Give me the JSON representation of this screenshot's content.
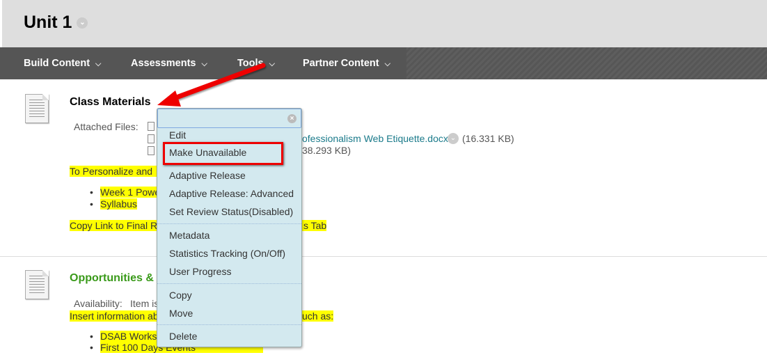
{
  "page": {
    "title": "Unit 1"
  },
  "nav": {
    "items": [
      {
        "label": "Build Content"
      },
      {
        "label": "Assessments"
      },
      {
        "label": "Tools"
      },
      {
        "label": "Partner Content"
      }
    ]
  },
  "items": [
    {
      "title": "Class Materials",
      "attached_label": "Attached Files:",
      "files": [
        {
          "name": "ofessionalism Web Etiquette.docx",
          "size": "(16.331 KB)"
        },
        {
          "size": "38.293 KB)"
        }
      ],
      "text1": "To Personalize and ",
      "bullets": [
        "Week 1 Powe",
        "Syllabus"
      ],
      "text2a": "Copy Link to Final R",
      "text2b": "s Tab"
    },
    {
      "title": "Opportunities &",
      "availability_label": "Availability:",
      "availability_value": "Item is",
      "text1a": "Insert information ab",
      "text1b": "uch as:",
      "bullets": [
        "DSAB Works",
        "First 100 Days Events"
      ]
    }
  ],
  "menu": {
    "items": [
      "Edit",
      "Make Unavailable",
      "Adaptive Release",
      "Adaptive Release: Advanced",
      "Set Review Status(Disabled)",
      "Metadata",
      "Statistics Tracking (On/Off)",
      "User Progress",
      "Copy",
      "Move",
      "Delete"
    ],
    "highlighted": "Make Unavailable"
  },
  "colors": {
    "header": "#dedede",
    "nav": "#555555",
    "menu": "#d3e9ef",
    "highlight": "#ffff00",
    "annotation": "#ee0000",
    "green_title": "#3a9a1a",
    "link": "#1a7a8a"
  }
}
